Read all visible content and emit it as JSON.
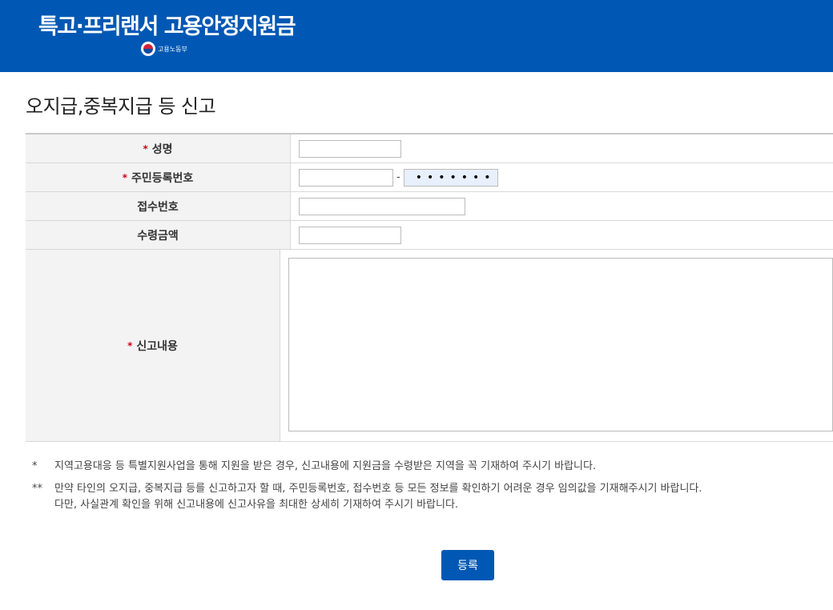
{
  "header": {
    "brand_title": "특고·프리랜서 고용안정지원금",
    "ministry": "고용노동부"
  },
  "page_title": "오지급,중복지급 등 신고",
  "form": {
    "required_mark": "*",
    "dash": "-",
    "rows": [
      {
        "label": "성명",
        "value": ""
      },
      {
        "label": "주민등록번호",
        "front_value": "",
        "back_value": "•••••••"
      },
      {
        "label": "접수번호",
        "value": ""
      },
      {
        "label": "수령금액",
        "value": ""
      },
      {
        "label": "신고내용",
        "value": ""
      }
    ]
  },
  "notes": [
    {
      "mark": "*",
      "lines": [
        "지역고용대응 등 특별지원사업을 통해 지원을 받은 경우, 신고내용에 지원금을 수령받은 지역을 꼭 기재하여 주시기 바랍니다."
      ]
    },
    {
      "mark": "**",
      "lines": [
        "만약 타인의 오지급, 중복지급 등를 신고하고자 할 때, 주민등록번호, 접수번호 등 모든 정보를 확인하기 어려운 경우 임의값을 기재해주시기 바랍니다.",
        "다만, 사실관계 확인을 위해 신고내용에 신고사유을 최대한 상세히 기재하여 주시기 바랍니다."
      ]
    }
  ],
  "submit_label": "등록"
}
